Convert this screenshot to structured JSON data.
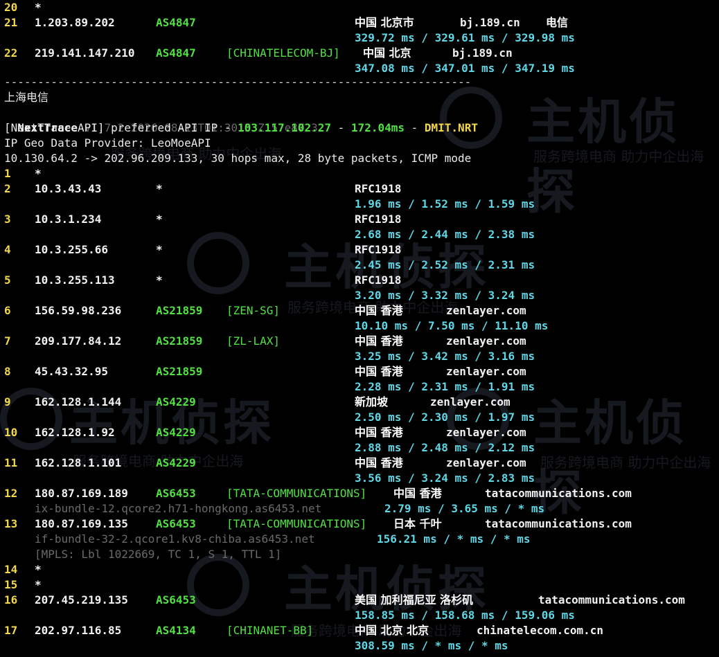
{
  "colors": {
    "hop": "#f2d84b",
    "asn": "#52e043",
    "latency": "#5fd7e6",
    "dim": "#6a6a6a"
  },
  "top_hops": [
    {
      "hop": "20",
      "ip": "*",
      "asn": "",
      "tag": "",
      "geo": "",
      "host": "",
      "isp": "",
      "lat": ""
    },
    {
      "hop": "21",
      "ip": "1.203.89.202",
      "asn": "AS4847",
      "tag": "",
      "geo": "中国 北京市",
      "host": "bj.189.cn",
      "isp": "电信",
      "lat": "329.72 ms / 329.61 ms / 329.98 ms"
    },
    {
      "hop": "22",
      "ip": "219.141.147.210",
      "asn": "AS4847",
      "tag": "[CHINATELECOM-BJ]",
      "geo": "中国 北京",
      "host": "bj.189.cn",
      "isp": "",
      "lat": "347.08 ms / 347.01 ms / 347.19 ms"
    }
  ],
  "separator": "----------------------------------------------------------------------",
  "header": {
    "title": "上海电信",
    "nt_name": "NextTrace",
    "nt_version": "v1.7.2 2026-08-13T01:30:53Z 57e8723",
    "api_label": "[NextTrace API] preferred API IP - ",
    "api_ip": "103.117.102.27",
    "api_dash1": " - ",
    "api_ms": "172.04ms",
    "api_dash2": " - ",
    "api_node": "DMIT.NRT",
    "geo_provider": "IP Geo Data Provider: LeoMoeAPI",
    "trace_cmd": "10.130.64.2 -> 202.96.209.133, 30 hops max, 28 byte packets, ICMP mode"
  },
  "hops": [
    {
      "hop": "1",
      "ip": "*",
      "asn": "",
      "tag": "",
      "geo": "",
      "host": "",
      "lat": "",
      "sub": ""
    },
    {
      "hop": "2",
      "ip": "10.3.43.43",
      "asn": "*",
      "tag": "",
      "geo": "RFC1918",
      "host": "",
      "lat": "1.96 ms / 1.52 ms / 1.59 ms",
      "sub": ""
    },
    {
      "hop": "3",
      "ip": "10.3.1.234",
      "asn": "*",
      "tag": "",
      "geo": "RFC1918",
      "host": "",
      "lat": "2.68 ms / 2.44 ms / 2.38 ms",
      "sub": ""
    },
    {
      "hop": "4",
      "ip": "10.3.255.66",
      "asn": "*",
      "tag": "",
      "geo": "RFC1918",
      "host": "",
      "lat": "2.45 ms / 2.52 ms / 2.31 ms",
      "sub": ""
    },
    {
      "hop": "5",
      "ip": "10.3.255.113",
      "asn": "*",
      "tag": "",
      "geo": "RFC1918",
      "host": "",
      "lat": "3.20 ms / 3.32 ms / 3.24 ms",
      "sub": ""
    },
    {
      "hop": "6",
      "ip": "156.59.98.236",
      "asn": "AS21859",
      "tag": "[ZEN-SG]",
      "geo": "中国 香港",
      "host": "zenlayer.com",
      "lat": "10.10 ms / 7.50 ms / 11.10 ms",
      "sub": ""
    },
    {
      "hop": "7",
      "ip": "209.177.84.12",
      "asn": "AS21859",
      "tag": "[ZL-LAX]",
      "geo": "中国 香港",
      "host": "zenlayer.com",
      "lat": "3.25 ms / 3.42 ms / 3.16 ms",
      "sub": ""
    },
    {
      "hop": "8",
      "ip": "45.43.32.95",
      "asn": "AS21859",
      "tag": "",
      "geo": "中国 香港",
      "host": "zenlayer.com",
      "lat": "2.28 ms / 2.31 ms / 1.91 ms",
      "sub": ""
    },
    {
      "hop": "9",
      "ip": "162.128.1.144",
      "asn": "AS4229",
      "tag": "",
      "geo": "新加坡",
      "host": "zenlayer.com",
      "lat": "2.50 ms / 2.30 ms / 1.97 ms",
      "sub": ""
    },
    {
      "hop": "10",
      "ip": "162.128.1.92",
      "asn": "AS4229",
      "tag": "",
      "geo": "中国 香港",
      "host": "zenlayer.com",
      "lat": "2.88 ms / 2.48 ms / 2.12 ms",
      "sub": ""
    },
    {
      "hop": "11",
      "ip": "162.128.1.101",
      "asn": "AS4229",
      "tag": "",
      "geo": "中国 香港",
      "host": "zenlayer.com",
      "lat": "3.56 ms / 3.24 ms / 2.83 ms",
      "sub": ""
    }
  ],
  "tata": [
    {
      "hop": "12",
      "ip": "180.87.169.189",
      "asn": "AS6453",
      "tag": "[TATA-COMMUNICATIONS]",
      "geo": "中国 香港",
      "host": "tatacommunications.com",
      "rdns": "ix-bundle-12.qcore2.h71-hongkong.as6453.net",
      "lat": "2.79 ms / 3.65 ms / * ms",
      "mpls": ""
    },
    {
      "hop": "13",
      "ip": "180.87.169.135",
      "asn": "AS6453",
      "tag": "[TATA-COMMUNICATIONS]",
      "geo": "日本 千叶",
      "host": "tatacommunications.com",
      "rdns": "if-bundle-32-2.qcore1.kv8-chiba.as6453.net",
      "lat": "156.21 ms / * ms / * ms",
      "mpls": "[MPLS: Lbl 1022669, TC 1, S 1, TTL 1]"
    }
  ],
  "tail": [
    {
      "hop": "14",
      "ip": "*"
    },
    {
      "hop": "15",
      "ip": "*"
    }
  ],
  "last": [
    {
      "hop": "16",
      "ip": "207.45.219.135",
      "asn": "AS6453",
      "tag": "",
      "geo": "美国 加利福尼亚 洛杉矶",
      "host": "tatacommunications.com",
      "lat": "158.85 ms / 158.68 ms / 159.06 ms"
    },
    {
      "hop": "17",
      "ip": "202.97.116.85",
      "asn": "AS4134",
      "tag": "[CHINANET-BB]",
      "geo": "中国 北京 北京",
      "host": "chinatelecom.com.cn",
      "lat": "308.59 ms / * ms / * ms"
    }
  ],
  "watermark": {
    "logo": "主机侦探",
    "slogan": "服务跨境电商 助力中企出海"
  }
}
